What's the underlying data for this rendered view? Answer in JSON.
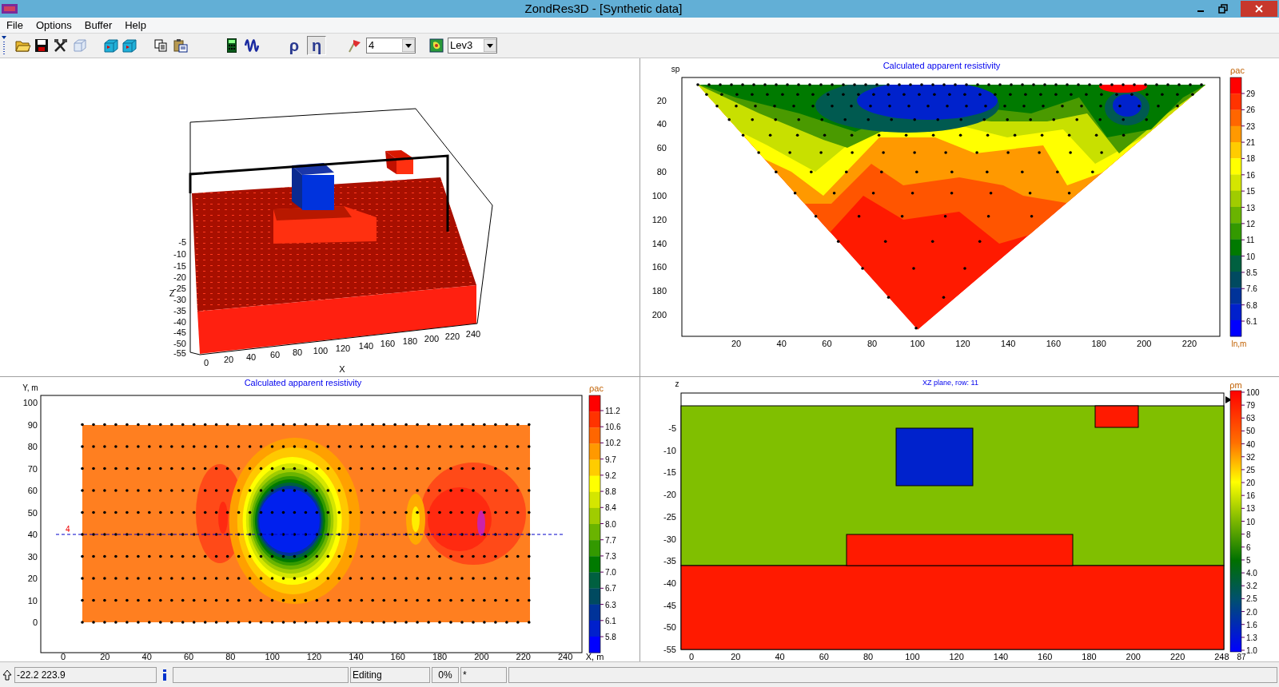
{
  "window": {
    "title": "ZondRes3D - [Synthetic data]"
  },
  "menu": [
    {
      "label": "File"
    },
    {
      "label": "Options"
    },
    {
      "label": "Buffer"
    },
    {
      "label": "Help"
    }
  ],
  "toolbar": {
    "parameter_buttons": [
      {
        "label": "ρ",
        "selected": false
      },
      {
        "label": "η",
        "selected": true
      }
    ],
    "profile_select": "4",
    "level_select": "Lev3"
  },
  "view_3d": {
    "z_axis_label": "Z",
    "z_ticks": [
      "-5",
      "-10",
      "-15",
      "-20",
      "-25",
      "-30",
      "-35",
      "-40",
      "-45",
      "-50",
      "-55"
    ],
    "x_axis_label": "X",
    "x_ticks": [
      "0",
      "20",
      "40",
      "60",
      "80",
      "100",
      "120",
      "140",
      "160",
      "180",
      "200",
      "220",
      "240"
    ]
  },
  "pseudosection": {
    "title": "Calculated apparent resistivity",
    "y_axis_label": "sp",
    "y_ticks": [
      "20",
      "40",
      "60",
      "80",
      "100",
      "120",
      "140",
      "160",
      "180",
      "200"
    ],
    "x_ticks": [
      "20",
      "40",
      "60",
      "80",
      "100",
      "120",
      "140",
      "160",
      "180",
      "200",
      "220"
    ],
    "x_axis_label": "ln,m",
    "scale": {
      "title": "ρac",
      "labels": [
        "29",
        "26",
        "23",
        "21",
        "18",
        "16",
        "15",
        "13",
        "12",
        "11",
        "10",
        "8.5",
        "7.6",
        "6.8",
        "6.1"
      ]
    }
  },
  "plan_map": {
    "title": "Calculated apparent resistivity",
    "y_axis_label": "Y, m",
    "y_ticks": [
      "100",
      "90",
      "80",
      "70",
      "60",
      "50",
      "40",
      "30",
      "20",
      "10",
      "0"
    ],
    "x_ticks": [
      "0",
      "20",
      "40",
      "60",
      "80",
      "100",
      "120",
      "140",
      "160",
      "180",
      "200",
      "220",
      "240"
    ],
    "x_axis_label": "X, m",
    "profile_label": "4",
    "scale": {
      "title": "ρac",
      "labels": [
        "11.2",
        "10.6",
        "10.2",
        "9.7",
        "9.2",
        "8.8",
        "8.4",
        "8.0",
        "7.7",
        "7.3",
        "7.0",
        "6.7",
        "6.3",
        "6.1",
        "5.8"
      ]
    }
  },
  "xz_section": {
    "title": "XZ plane, row: 11",
    "y_axis_label": "z",
    "y_ticks": [
      "-5",
      "-10",
      "-15",
      "-20",
      "-25",
      "-30",
      "-35",
      "-40",
      "-45",
      "-50",
      "-55"
    ],
    "x_ticks": [
      "0",
      "20",
      "40",
      "60",
      "80",
      "100",
      "120",
      "140",
      "160",
      "180",
      "200",
      "220",
      "248"
    ],
    "cursor_value": "87",
    "scale": {
      "title": "ρm",
      "labels": [
        "100",
        "79",
        "63",
        "50",
        "40",
        "32",
        "25",
        "20",
        "16",
        "13",
        "10",
        "8",
        "6",
        "5",
        "4.0",
        "3.2",
        "2.5",
        "2.0",
        "1.6",
        "1.3",
        "1.0"
      ]
    }
  },
  "status_bar": {
    "coordinates": "-22.2 223.9",
    "mode": "Editing",
    "progress": "0%",
    "modified": "*"
  }
}
